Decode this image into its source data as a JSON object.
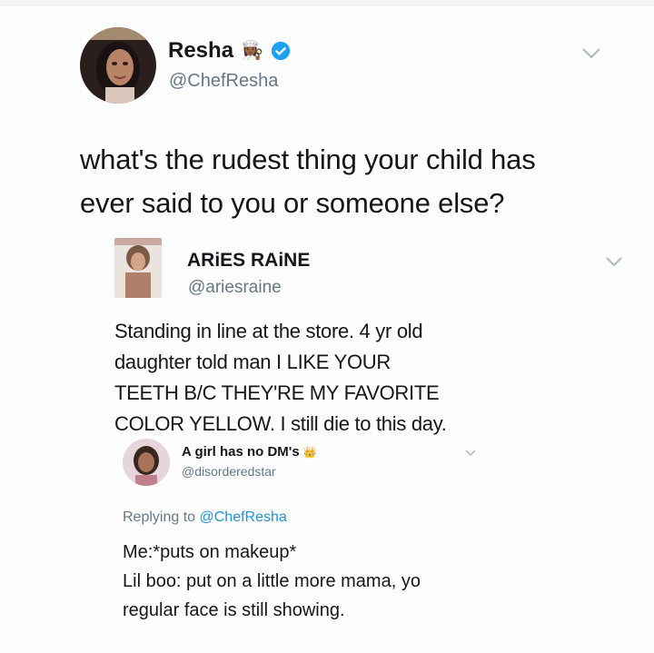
{
  "tweet_main": {
    "display_name": "Resha",
    "emoji": "👩🏾‍🍳",
    "verified": true,
    "handle": "@ChefResha",
    "text_lines": [
      "what's the rudest thing your child has",
      "ever said to you or someone else?"
    ]
  },
  "reply_1": {
    "display_name": "ARiES RAiNE",
    "handle": "@ariesraine",
    "text_lines": [
      "Standing in line at the store. 4 yr old",
      "daughter told man I LIKE YOUR",
      "TEETH B/C THEY'RE MY FAVORITE",
      "COLOR YELLOW. I still die to this day."
    ]
  },
  "reply_2": {
    "display_name": "A girl has no DM's",
    "emoji": "👑",
    "handle": "@disorderedstar",
    "replying_prefix": "Replying to",
    "replying_to": "@ChefResha",
    "text_lines": [
      "Me:*puts on makeup*",
      "Lil boo: put on a little more mama, yo",
      "regular face is still showing."
    ]
  },
  "colors": {
    "verified_badge": "#1da1f2",
    "link": "#1b95e0",
    "secondary_text": "#657786"
  }
}
